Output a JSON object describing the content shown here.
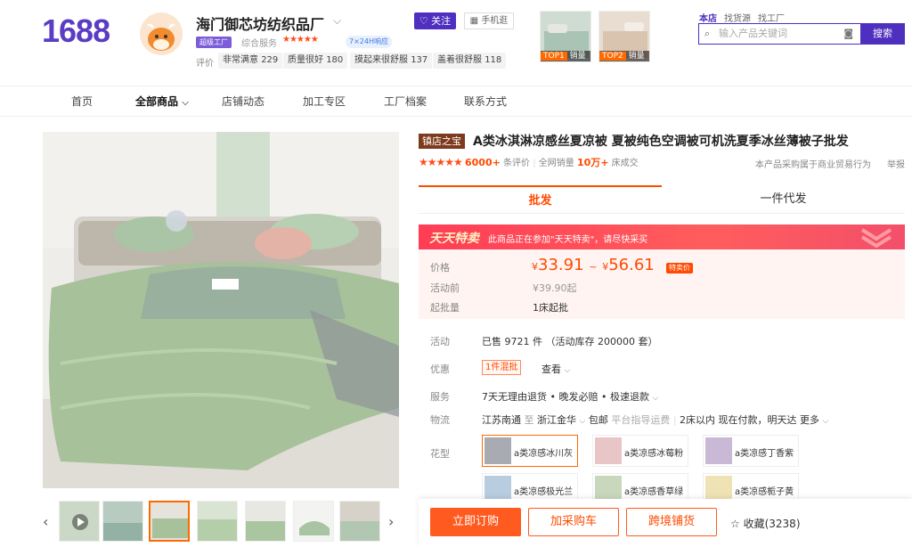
{
  "colors": {
    "brand": "#5b3cc4",
    "accent": "#ff4a00",
    "promo": "#ff3d55"
  },
  "header": {
    "logo": "1688",
    "shop_name": "海门御芯坊纺织品厂",
    "follow_label": "关注",
    "mobile_label": "手机逛",
    "factory_badge": "超级工厂",
    "service_label": "综合服务",
    "service_stars": "★★★★★",
    "response_badge": "7×24H响应",
    "rating_label": "评价",
    "rating_tags": [
      {
        "text": "非常满意",
        "count": "229"
      },
      {
        "text": "质量很好",
        "count": "180"
      },
      {
        "text": "摸起来很舒服",
        "count": "137"
      },
      {
        "text": "盖着很舒服",
        "count": "118"
      }
    ],
    "top_products": [
      {
        "tag": "TOP1",
        "label": "销量"
      },
      {
        "tag": "TOP2",
        "label": "销量"
      }
    ],
    "search_tabs": [
      "本店",
      "找货源",
      "找工厂"
    ],
    "search_placeholder": "输入产品关键词",
    "search_button": "搜索"
  },
  "nav": [
    "首页",
    "全部商品",
    "店铺动态",
    "加工专区",
    "工厂档案",
    "联系方式"
  ],
  "product": {
    "title_tag": "镇店之宝",
    "title": "A类冰淇淋凉感丝夏凉被 夏被纯色空调被可机洗夏季冰丝薄被子批发",
    "stars": "★★★★★",
    "review_count": "6000+",
    "review_unit": "条评价",
    "sales_label": "全网销量",
    "sales_count": "10万+",
    "sales_unit": "床成交",
    "trade_note": "本产品采购属于商业贸易行为",
    "report": "举报",
    "tabs": [
      "批发",
      "一件代发"
    ],
    "promo_title": "天天特卖",
    "promo_text": "此商品正在参加\"天天特卖\"，请尽快采买",
    "price_label": "价格",
    "price_low": "33.91",
    "price_high": "56.61",
    "currency": "¥",
    "price_sep": "~",
    "sale_tag": "特卖价",
    "before_label": "活动前",
    "before_value": "¥39.90起",
    "moq_label": "起批量",
    "moq_value": "1床起批",
    "activity_label": "活动",
    "activity_value": "已售 9721 件 （活动库存 200000 套）",
    "discount_label": "优惠",
    "discount_tag": "1件混批",
    "discount_view": "查看",
    "service_label": "服务",
    "service_value": "7天无理由退货 • 晚发必赔 • 极速退款",
    "logistics_label": "物流",
    "logistics_from": "江苏南通",
    "logistics_to_word": "至",
    "logistics_to": "浙江金华",
    "logistics_ship": "包邮",
    "logistics_fee": "平台指导运费",
    "logistics_time": "2床以内 现在付款，明天达",
    "logistics_more": "更多",
    "variant_label": "花型",
    "variants": [
      "a类凉感冰川灰",
      "a类凉感冰莓粉",
      "a类凉感丁香紫",
      "a类凉感极光兰",
      "a类凉感香草绿",
      "a类凉感栀子黄"
    ],
    "variant_colors": [
      "#a8acb2",
      "#e8c6c8",
      "#c9b9d6",
      "#b9cde0",
      "#c9d8bc",
      "#efe2b4"
    ],
    "buy_now": "立即订购",
    "add_cart": "加采购车",
    "cross_border": "跨境铺货",
    "favorite": "收藏(3238)"
  }
}
